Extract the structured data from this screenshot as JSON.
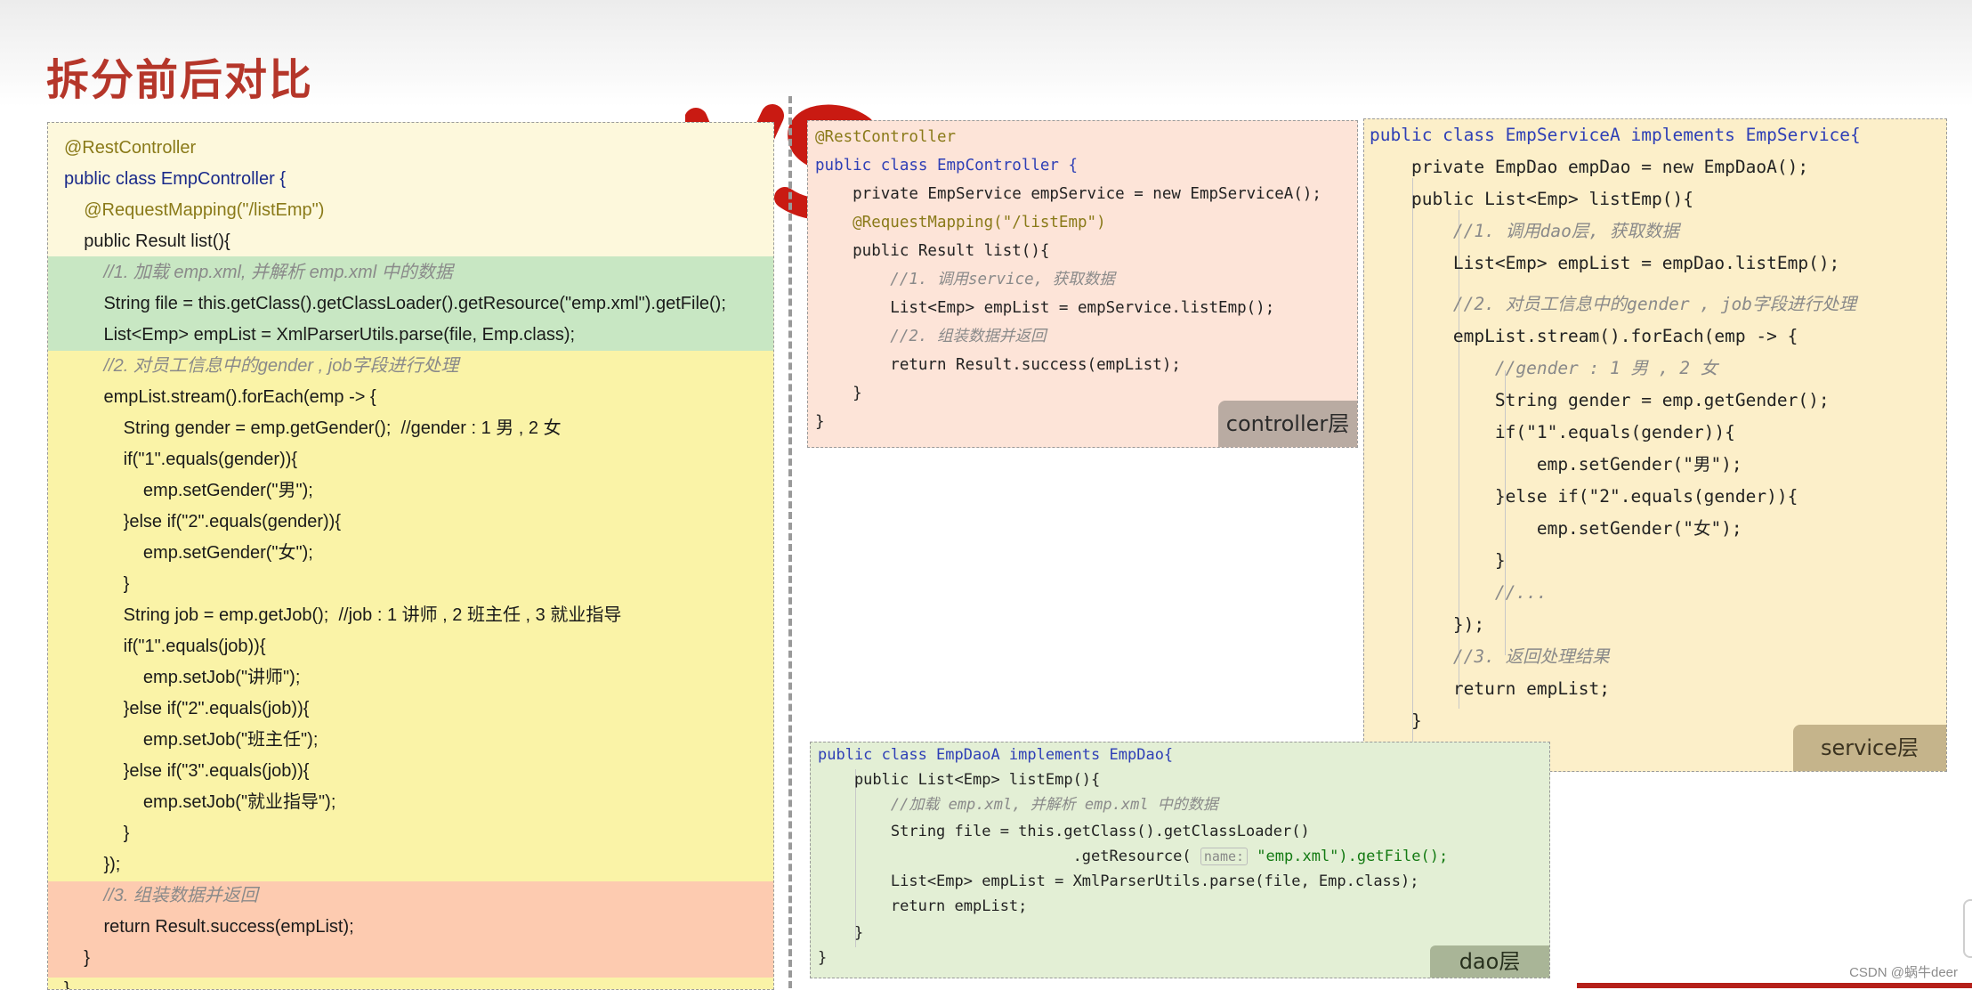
{
  "page": {
    "title": "拆分前后对比",
    "vs_label": "VS",
    "watermark": "CSDN @蜗牛deer"
  },
  "left_block": {
    "lines": [
      "@RestController",
      "public class EmpController {",
      "    @RequestMapping(\"/listEmp\")",
      "    public Result list(){",
      "        //1. 加载 emp.xml, 并解析 emp.xml 中的数据",
      "        String file = this.getClass().getClassLoader().getResource(\"emp.xml\").getFile();",
      "        List<Emp> empList = XmlParserUtils.parse(file, Emp.class);",
      "        //2. 对员工信息中的gender , job字段进行处理",
      "        empList.stream().forEach(emp -> {",
      "            String gender = emp.getGender();  //gender : 1 男 , 2 女",
      "            if(\"1\".equals(gender)){",
      "                emp.setGender(\"男\");",
      "            }else if(\"2\".equals(gender)){",
      "                emp.setGender(\"女\");",
      "            }",
      "            String job = emp.getJob();  //job : 1 讲师 , 2 班主任 , 3 就业指导",
      "            if(\"1\".equals(job)){",
      "                emp.setJob(\"讲师\");",
      "            }else if(\"2\".equals(job)){",
      "                emp.setJob(\"班主任\");",
      "            }else if(\"3\".equals(job)){",
      "                emp.setJob(\"就业指导\");",
      "            }",
      "        });",
      "        //3. 组装数据并返回",
      "        return Result.success(empList);",
      "    }",
      "}"
    ]
  },
  "controller_block": {
    "label": "controller层",
    "lines": [
      "@RestController",
      "public class EmpController {",
      "    private EmpService empService = new EmpServiceA();",
      "    @RequestMapping(\"/listEmp\")",
      "    public Result list(){",
      "        //1. 调用service, 获取数据",
      "        List<Emp> empList = empService.listEmp();",
      "        //2. 组装数据并返回",
      "        return Result.success(empList);",
      "    }",
      "}"
    ]
  },
  "service_block": {
    "label": "service层",
    "lines": [
      "public class EmpServiceA implements EmpService{",
      "    private EmpDao empDao = new EmpDaoA();",
      "    public List<Emp> listEmp(){",
      "        //1. 调用dao层, 获取数据",
      "        List<Emp> empList = empDao.listEmp();",
      "        //2. 对员工信息中的gender , job字段进行处理",
      "        empList.stream().forEach(emp -> {",
      "            //gender : 1 男 , 2 女",
      "            String gender = emp.getGender();",
      "            if(\"1\".equals(gender)){",
      "                emp.setGender(\"男\");",
      "            }else if(\"2\".equals(gender)){",
      "                emp.setGender(\"女\");",
      "            }",
      "            //...",
      "        });",
      "        //3. 返回处理结果",
      "        return empList;",
      "    }"
    ]
  },
  "dao_block": {
    "label": "dao层",
    "hint": "name:",
    "lines": [
      "public class EmpDaoA implements EmpDao{",
      "    public List<Emp> listEmp(){",
      "        //加载 emp.xml, 并解析 emp.xml 中的数据",
      "        String file = this.getClass().getClassLoader()",
      "                            .getResource(",
      "        List<Emp> empList = XmlParserUtils.parse(file, Emp.class);",
      "        return empList;",
      "    }",
      "}"
    ],
    "get_resource_tail": "\"emp.xml\").getFile();"
  }
}
